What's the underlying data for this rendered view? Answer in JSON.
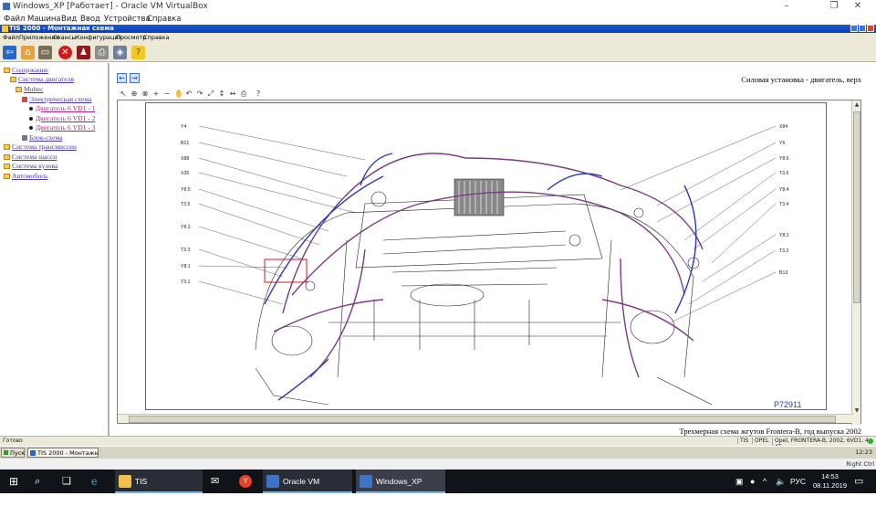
{
  "host": {
    "title": "Windows_XP [Работает] - Oracle VM VirtualBox",
    "menu": [
      "Файл",
      "Машина",
      "Вид",
      "Ввод",
      "Устройства",
      "Справка"
    ],
    "window_controls": [
      "–",
      "❐",
      "✕"
    ]
  },
  "tis": {
    "title": "TIS 2000 - Монтажная схема",
    "menu": [
      "Файл",
      "Приложения",
      "Сеансы",
      "Конфигурация",
      "Просмотр",
      "Справка"
    ]
  },
  "tree": {
    "items": [
      {
        "label": "Содержание",
        "level": 0
      },
      {
        "label": "Система двигателя",
        "level": 1
      },
      {
        "label": "Multec",
        "level": 2
      },
      {
        "label": "Электрическая схема",
        "level": 3
      },
      {
        "label": "Двигатель 6 VD1 - 1",
        "level": 4
      },
      {
        "label": "Двигатель 6 VD1 - 2",
        "level": 4
      },
      {
        "label": "Двигатель 6 VD1 - 3",
        "level": 4
      },
      {
        "label": "Блок-схема",
        "level": 3
      },
      {
        "label": "Система трансмиссии",
        "level": 0
      },
      {
        "label": "Система шасси",
        "level": 0
      },
      {
        "label": "Система кузова",
        "level": 0
      },
      {
        "label": "Автомобиль",
        "level": 0
      }
    ]
  },
  "content": {
    "page_title": "Силовая установка - двигатель, верх",
    "caption": "Трехмерная схема жгутов Frontera-B, год выпуска 2002",
    "figure_id": "P72911",
    "left_labels": [
      "Y4",
      "B21",
      "X88",
      "X35",
      "Y8.5",
      "T3.5",
      "Y8.3",
      "T3.3",
      "Y8.1",
      "T3.1"
    ],
    "right_labels": [
      "X84",
      "Y6",
      "Y8.6",
      "T3.6",
      "Y8.4",
      "T3.4",
      "Y8.2",
      "T3.2",
      "B13"
    ]
  },
  "status": {
    "left": "Готово",
    "segments": [
      "TIS",
      "OPEL",
      "Opel, FRONTERA-B, 2002, 6VD1, 4-AT"
    ]
  },
  "xp_taskbar": {
    "start": "Пуск",
    "task": "TIS 2000 - Монтажн...",
    "time": "12:23"
  },
  "vb_status": {
    "host_key": "Right Ctrl"
  },
  "win_taskbar": {
    "apps": [
      "TIS",
      "Oracle VM VirtualB...",
      "Windows_XP [Работ..."
    ],
    "lang": "РУС",
    "time": "14:53",
    "date": "08.11.2019"
  },
  "colors": {
    "xp_blue": "#0a3fb5",
    "harness_purple": "#7a3a86",
    "harness_blue": "#2b3bb0",
    "highlight_red": "#c02020",
    "figure_id_blue": "#2a3ab2"
  }
}
